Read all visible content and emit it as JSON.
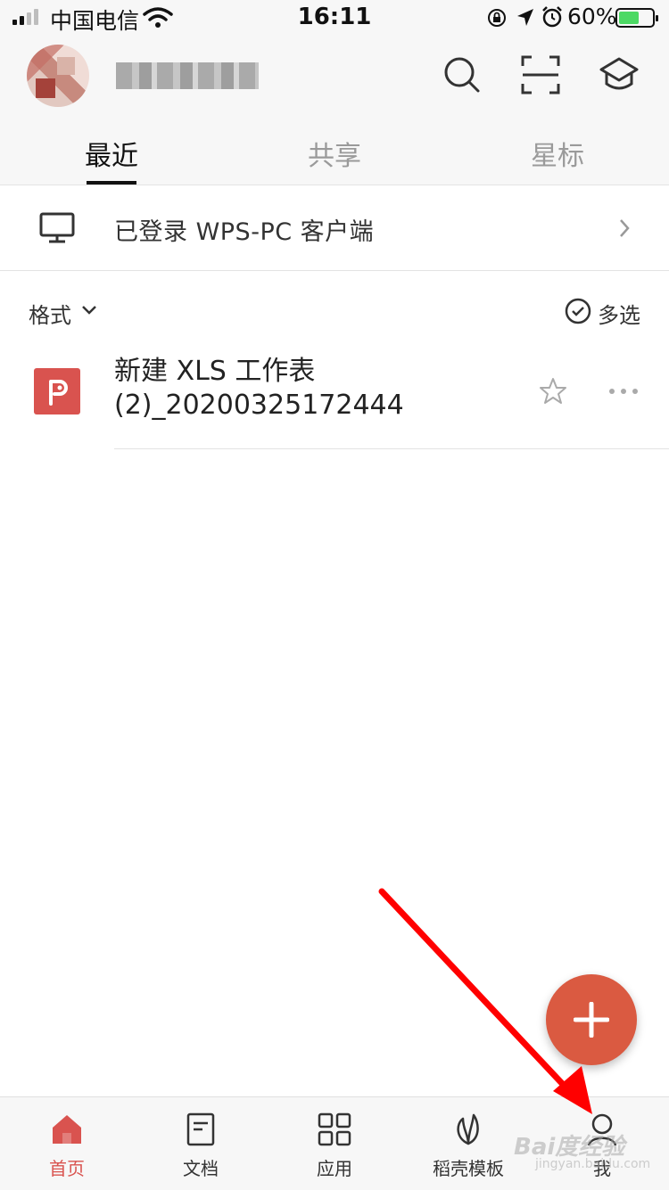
{
  "status_bar": {
    "carrier": "中国电信",
    "time": "16:11",
    "battery_percent": "60%",
    "battery_level": 0.6,
    "icons": [
      "signal-icon",
      "wifi-icon",
      "rotation-lock-icon",
      "location-icon",
      "alarm-icon",
      "battery-icon"
    ]
  },
  "header": {
    "icons": [
      "search-icon",
      "scan-icon",
      "graduation-cap-icon"
    ]
  },
  "tabs": [
    {
      "label": "最近",
      "active": true
    },
    {
      "label": "共享",
      "active": false
    },
    {
      "label": "星标",
      "active": false
    }
  ],
  "pc_login": {
    "label": "已登录 WPS-PC 客户端",
    "icon": "monitor-icon"
  },
  "filter": {
    "format_label": "格式",
    "multi_select_label": "多选"
  },
  "files": [
    {
      "name_line1": "新建 XLS 工作表",
      "name_line2": "(2)_20200325172444",
      "icon": "wps-presentation-icon",
      "icon_color": "#d9534f"
    }
  ],
  "fab": {
    "icon": "plus-icon",
    "color": "#da5a41"
  },
  "bottom_nav": [
    {
      "label": "首页",
      "icon": "home-icon",
      "active": true
    },
    {
      "label": "文档",
      "icon": "document-icon",
      "active": false
    },
    {
      "label": "应用",
      "icon": "apps-grid-icon",
      "active": false
    },
    {
      "label": "稻壳模板",
      "icon": "leaf-icon",
      "active": false
    },
    {
      "label": "我",
      "icon": "person-icon",
      "active": false
    }
  ],
  "annotation": {
    "color": "#ff0000"
  },
  "watermark": {
    "text": "Bai度经验",
    "url": "jingyan.baidu.com"
  },
  "colors": {
    "accent": "#d9534f",
    "topbar_bg": "#f7f7f7"
  }
}
